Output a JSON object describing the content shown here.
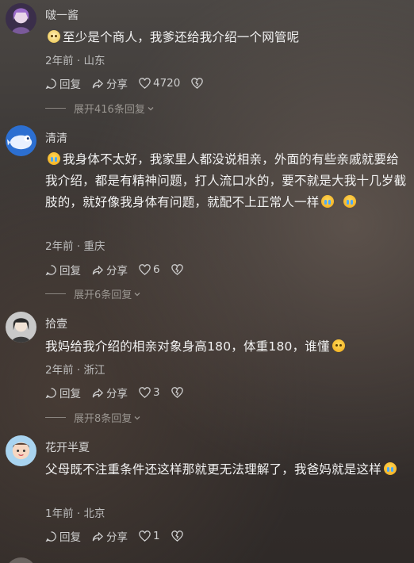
{
  "comments": [
    {
      "username": "啵一酱",
      "text": "至少是个商人，我爹还给我介绍一个网管呢",
      "meta": "2年前 · 山东",
      "reply_label": "回复",
      "share_label": "分享",
      "likes": "4720",
      "expand": "展开416条回复"
    },
    {
      "username": "清清",
      "text": "我身体不太好，我家里人都没说相亲，外面的有些亲戚就要给我介绍，都是有精神问题，打人流口水的，要不就是大我十几岁截肢的，就好像我身体有问题，就配不上正常人一样",
      "meta": "2年前 · 重庆",
      "reply_label": "回复",
      "share_label": "分享",
      "likes": "6",
      "expand": "展开6条回复"
    },
    {
      "username": "拾壹",
      "text": "我妈给我介绍的相亲对象身高180，体重180，谁懂",
      "meta": "2年前 · 浙江",
      "reply_label": "回复",
      "share_label": "分享",
      "likes": "3",
      "expand": "展开8条回复"
    },
    {
      "username": "花开半夏",
      "text": "父母既不注重条件还这样那就更无法理解了，我爸妈就是这样",
      "meta": "1年前 · 北京",
      "reply_label": "回复",
      "share_label": "分享",
      "likes": "1"
    }
  ]
}
